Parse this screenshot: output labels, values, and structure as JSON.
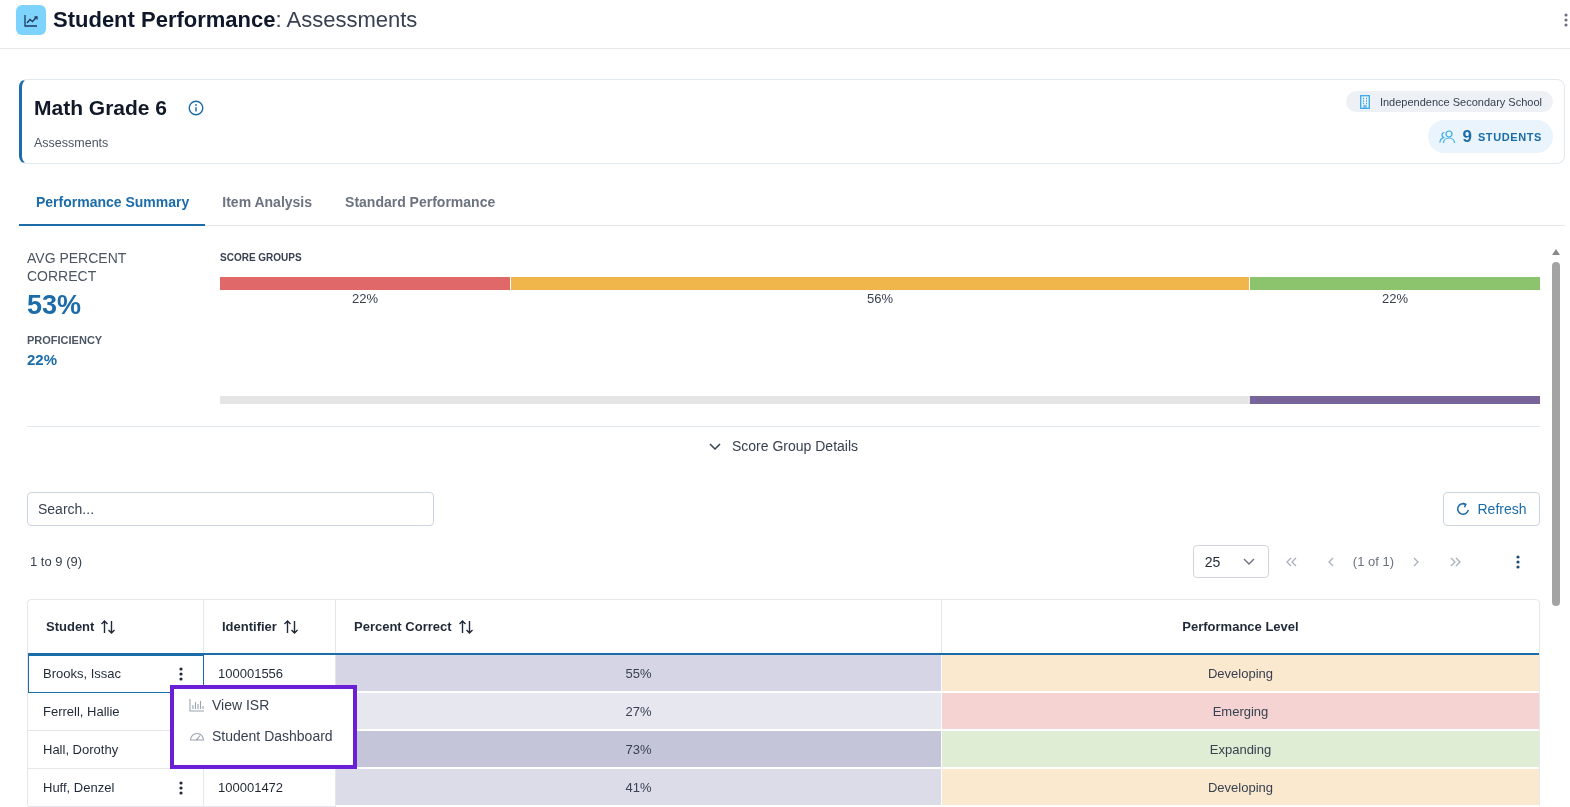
{
  "header": {
    "title": "**Student Performance**: Assessments"
  },
  "course": {
    "title": "Math Grade 6",
    "subtitle": "Assessments",
    "school": "Independence Secondary School",
    "student_count": "9",
    "student_label": "STUDENTS"
  },
  "tabs": [
    {
      "label": "Performance Summary",
      "selected": true
    },
    {
      "label": "Item Analysis",
      "selected": false
    },
    {
      "label": "Standard Performance",
      "selected": false
    }
  ],
  "summary": {
    "avg_label": "AVG PERCENT CORRECT",
    "avg_value": "53%",
    "proficiency_label": "PROFICIENCY",
    "proficiency_value": "22%"
  },
  "score_groups": {
    "title": "SCORE GROUPS",
    "segments": [
      {
        "label": "22%",
        "level": 0.22,
        "color": "#e06868"
      },
      {
        "label": "56%",
        "level": 0.56,
        "color": "#f0b64c"
      },
      {
        "label": "22%",
        "level": 0.22,
        "color": "#8bc46d"
      }
    ],
    "proficiency_bar": {
      "level": 0.22
    }
  },
  "details_toggle": {
    "label": "Score Group Details",
    "expanded": false
  },
  "toolbar": {
    "search_placeholder": "Search...",
    "refresh": "Refresh"
  },
  "pagination": {
    "range": "1 to 9 (9)",
    "page_size": "25",
    "page": "(1 of 1)",
    "navigation_disabled": true
  },
  "table": {
    "columns": [
      {
        "label": "Student",
        "sortable": true
      },
      {
        "label": "Identifier",
        "sortable": true
      },
      {
        "label": "Percent Correct",
        "sortable": true
      },
      {
        "label": "Performance Level",
        "sortable": false
      }
    ],
    "rows": [
      {
        "student": "Brooks, Issac",
        "identifier": "100001556",
        "percent": {
          "text": "55%",
          "color": "#d5d5e5"
        },
        "performance": {
          "text": "Developing",
          "color": "#fbe9cf"
        },
        "focused": true,
        "menu_button": true
      },
      {
        "student": "Ferrell, Hallie",
        "percent": {
          "text": "27%",
          "color": "#e7e7f0"
        },
        "performance": {
          "text": "Emerging",
          "color": "#f5d3d3"
        },
        "focused": false
      },
      {
        "student": "Hall, Dorothy",
        "percent": {
          "text": "73%",
          "color": "#c5c5da"
        },
        "performance": {
          "text": "Expanding",
          "color": "#deedd3"
        },
        "focused": false
      },
      {
        "student": "Huff, Denzel",
        "identifier": "100001472",
        "percent": {
          "text": "41%",
          "color": "#dcdce9"
        },
        "performance": {
          "text": "Developing",
          "color": "#fbe9cf"
        },
        "focused": false,
        "menu_button": true
      }
    ]
  },
  "row_menu": {
    "items": [
      {
        "label": "View ISR",
        "kind": "chart"
      },
      {
        "label": "Student Dashboard",
        "kind": "gauge"
      }
    ]
  }
}
